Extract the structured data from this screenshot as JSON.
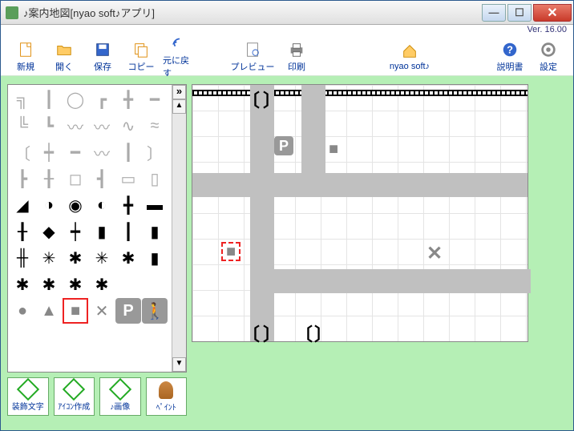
{
  "title": "♪案内地図[nyao soft♪アプリ]",
  "version": "Ver. 16.00",
  "toolbar": {
    "new": "新規",
    "open": "開く",
    "save": "保存",
    "copy": "コピー",
    "undo": "元に戻す",
    "preview": "プレビュー",
    "print": "印刷",
    "brand": "nyao soft♪",
    "help": "説明書",
    "settings": "設定"
  },
  "subtools": {
    "decorate": "装飾文字",
    "icon_make": "ｱｲｺﾝ作成",
    "image": "♪画像",
    "paint": "ﾍﾟｲﾝﾄ"
  },
  "palette": {
    "selected_icon": "square-icon",
    "icons_row_bottom": [
      "circle",
      "triangle",
      "square",
      "cross",
      "parking",
      "walk"
    ]
  },
  "canvas": {
    "placed": [
      {
        "icon": "parking",
        "label": "P"
      },
      {
        "icon": "square"
      },
      {
        "icon": "square",
        "selected": true
      },
      {
        "icon": "cross",
        "label": "✕"
      }
    ]
  }
}
